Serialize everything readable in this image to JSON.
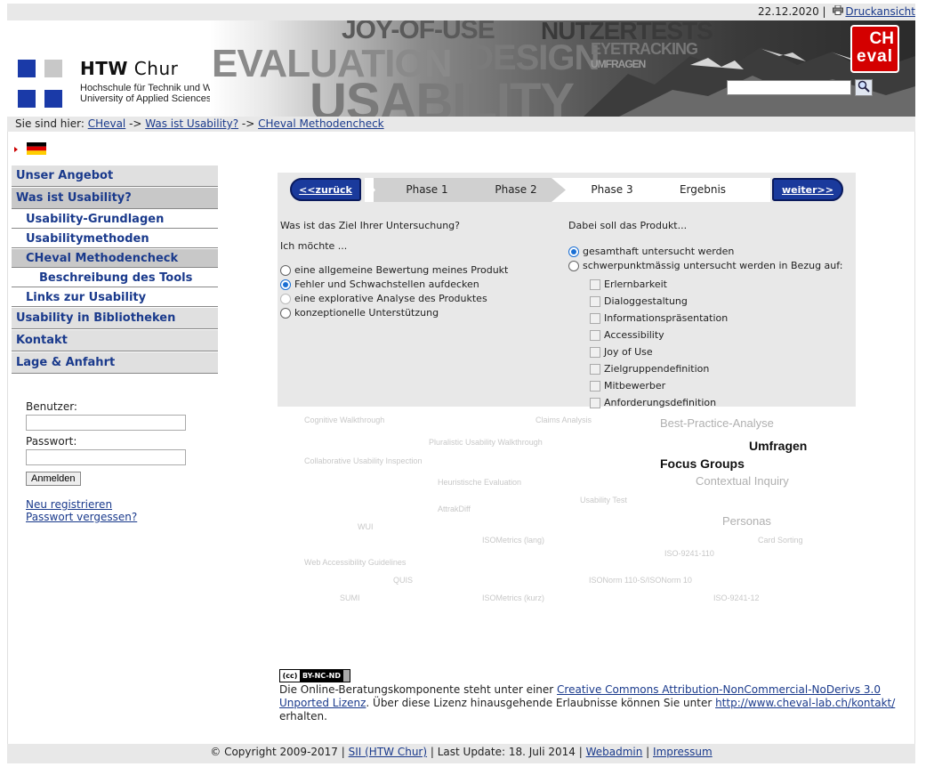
{
  "topbar": {
    "date": "22.12.2020",
    "separator": "|",
    "print_icon": "printer-icon",
    "print_label": "Druckansicht"
  },
  "header": {
    "logo_name": "HTW",
    "logo_city": " Chur",
    "logo_sub1": "Hochschule für Technik und Wirtschaft",
    "logo_sub2": "University of Applied Sciences",
    "banner_words": [
      "JOY-OF-USE",
      "NUTZERTESTS",
      "EVALUATION",
      "DESIGN",
      "EYETRACKING",
      "UMFRAGEN",
      "USABILITY"
    ],
    "cheval_top": "CH",
    "cheval_bottom": "eval",
    "search_placeholder": "",
    "search_icon": "magnifier-icon"
  },
  "breadcrumb": {
    "prefix": "Sie sind hier: ",
    "items": [
      "CHeval",
      "Was ist Usability?",
      "CHeval Methodencheck"
    ],
    "sep": " -> "
  },
  "sidebar": {
    "items": [
      {
        "label": "Unser Angebot"
      },
      {
        "label": "Was ist Usability?"
      },
      {
        "label": "Usability-Grundlagen"
      },
      {
        "label": "Usabilitymethoden"
      },
      {
        "label": "CHeval Methodencheck"
      },
      {
        "label": "Beschreibung des Tools"
      },
      {
        "label": "Links zur Usability"
      },
      {
        "label": "Usability in Bibliotheken"
      },
      {
        "label": "Kontakt"
      },
      {
        "label": "Lage & Anfahrt"
      }
    ]
  },
  "login": {
    "user_label": "Benutzer:",
    "pass_label": "Passwort:",
    "submit": "Anmelden",
    "register": "Neu registrieren",
    "forgot": "Passwort vergessen?"
  },
  "wizard": {
    "back": "<<zurück",
    "next": "weiter>>",
    "phases": [
      "Phase 1",
      "Phase 2",
      "Phase 3",
      "Ergebnis"
    ],
    "left_question": "Was ist das Ziel Ihrer Untersuchung?",
    "left_sub": "Ich möchte ...",
    "left_options": [
      "eine allgemeine Bewertung meines Produkt",
      "Fehler und Schwachstellen aufdecken",
      "eine explorative Analyse des Produktes",
      "konzeptionelle Unterstützung"
    ],
    "right_question": "Dabei soll das Produkt...",
    "right_options": [
      "gesamthaft untersucht werden",
      "schwerpunktmässig untersucht werden in Bezug auf:"
    ],
    "checkboxes": [
      "Erlernbarkeit",
      "Dialoggestaltung",
      "Informationspräsentation",
      "Accessibility",
      "Joy of Use",
      "Zielgruppendefinition",
      "Mitbewerber",
      "Anforderungsdefinition"
    ]
  },
  "cloud": {
    "tags": [
      "Cognitive Walkthrough",
      "Claims Analysis",
      "Best-Practice-Analyse",
      "Pluralistic Usability Walkthrough",
      "Umfragen",
      "Collaborative Usability Inspection",
      "Focus Groups",
      "Heuristische Evaluation",
      "Contextual Inquiry",
      "Usability Test",
      "AttrakDiff",
      "Personas",
      "WUI",
      "ISOMetrics (lang)",
      "Card Sorting",
      "ISO-9241-110",
      "Web Accessibility Guidelines",
      "QUIS",
      "ISONorm 110-S/ISONorm 10",
      "SUMI",
      "ISOMetrics (kurz)",
      "ISO-9241-12"
    ]
  },
  "license": {
    "badge_cc": "(cc)",
    "badge_rest": "BY-NC-ND",
    "text1": "Die Online-Beratungskomponente steht unter einer ",
    "link1": "Creative Commons Attribution-NonCommercial-NoDerivs 3.0 Unported Lizenz",
    "text2": ". Über diese Lizenz hinausgehende Erlaubnisse können Sie unter ",
    "link2": "http://www.cheval-lab.ch/kontakt/",
    "text3": " erhalten."
  },
  "footer": {
    "copyright": "© Copyright 2009-2017 | ",
    "link1": "SII (HTW Chur)",
    "mid": " | Last Update: 18. Juli 2014 | ",
    "link2": "Webadmin",
    "sep": " | ",
    "link3": "Impressum"
  },
  "colors": {
    "nav_blue": "#1a3a8c",
    "button_blue": "#1a3a9c",
    "brand_red": "#d40000",
    "logo_blue": "#1a3aa8"
  }
}
